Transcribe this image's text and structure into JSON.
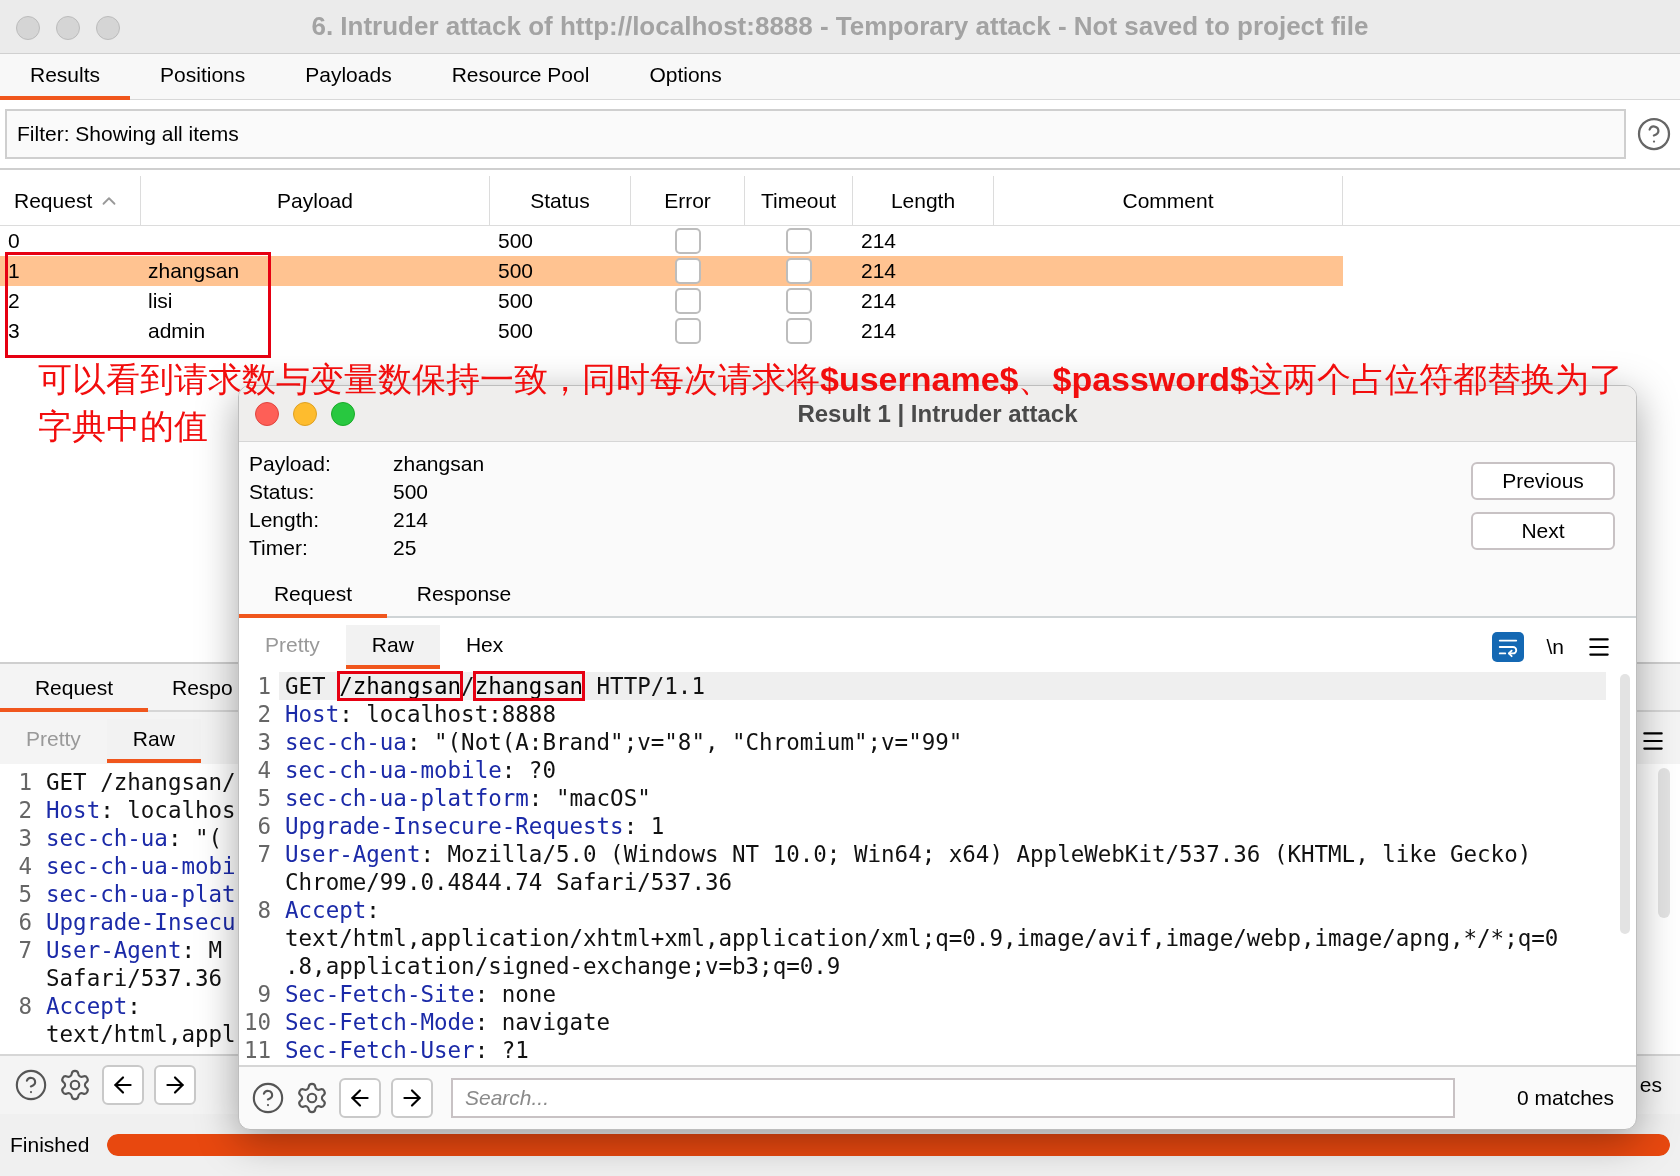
{
  "window": {
    "title": "6. Intruder attack of http://localhost:8888 - Temporary attack - Not saved to project file"
  },
  "tabs": [
    {
      "label": "Results",
      "selected": true
    },
    {
      "label": "Positions",
      "selected": false
    },
    {
      "label": "Payloads",
      "selected": false
    },
    {
      "label": "Resource Pool",
      "selected": false
    },
    {
      "label": "Options",
      "selected": false
    }
  ],
  "filter": {
    "value": "Filter: Showing all items"
  },
  "table": {
    "columns": [
      {
        "label": "Request",
        "sorted": true
      },
      {
        "label": "Payload",
        "sorted": false
      },
      {
        "label": "Status",
        "sorted": false
      },
      {
        "label": "Error",
        "sorted": false
      },
      {
        "label": "Timeout",
        "sorted": false
      },
      {
        "label": "Length",
        "sorted": false
      },
      {
        "label": "Comment",
        "sorted": false
      }
    ],
    "rows": [
      {
        "request": "0",
        "status": "500",
        "error": false,
        "timeout": false,
        "length": "214",
        "selected": false
      },
      {
        "request": "1",
        "payload": "zhangsan",
        "status": "500",
        "error": false,
        "timeout": false,
        "length": "214",
        "selected": true
      },
      {
        "request": "2",
        "payload": "lisi",
        "status": "500",
        "error": false,
        "timeout": false,
        "length": "214",
        "selected": false
      },
      {
        "request": "3",
        "payload": "admin",
        "status": "500",
        "error": false,
        "timeout": false,
        "length": "214",
        "selected": false
      }
    ]
  },
  "annotation": {
    "lines": [
      "可以看到请求数与变量数保持一致，同时每次请求将**$username$**、**$password$**这两个占位符都替换为了",
      "字典中的值"
    ]
  },
  "lower_panel": {
    "tabs": [
      {
        "label": "Request",
        "selected": true
      },
      {
        "label": "Respo",
        "selected": false
      }
    ],
    "view_tabs": [
      {
        "label": "Pretty",
        "selected": false,
        "disabled": true
      },
      {
        "label": "Raw",
        "selected": true,
        "disabled": false
      }
    ],
    "code": [
      {
        "number": "1",
        "segments": [
          {
            "text": "GET /zhangsan/",
            "kind": "plain"
          }
        ]
      },
      {
        "number": "2",
        "segments": [
          {
            "text": "Host",
            "kind": "key"
          },
          {
            "text": ": localhos",
            "kind": "plain"
          }
        ]
      },
      {
        "number": "3",
        "segments": [
          {
            "text": "sec-ch-ua",
            "kind": "key"
          },
          {
            "text": ": \"(",
            "kind": "plain"
          }
        ]
      },
      {
        "number": "4",
        "segments": [
          {
            "text": "sec-ch-ua-mobi",
            "kind": "key"
          }
        ]
      },
      {
        "number": "5",
        "segments": [
          {
            "text": "sec-ch-ua-plat",
            "kind": "key"
          }
        ]
      },
      {
        "number": "6",
        "segments": [
          {
            "text": "Upgrade-Insecu",
            "kind": "key"
          }
        ]
      },
      {
        "number": "7",
        "segments": [
          {
            "text": "User-Agent",
            "kind": "key"
          },
          {
            "text": ": M",
            "kind": "plain"
          }
        ]
      },
      {
        "segments": [
          {
            "text": "Safari/537.36",
            "kind": "plain"
          }
        ]
      },
      {
        "number": "8",
        "segments": [
          {
            "text": "Accept",
            "kind": "key"
          },
          {
            "text": ":",
            "kind": "plain"
          }
        ]
      },
      {
        "segments": [
          {
            "text": "text/html,appl",
            "kind": "plain"
          }
        ]
      }
    ],
    "matches_fragment": "es"
  },
  "status_bar": {
    "text": "Finished",
    "progress": {
      "level": 1
    }
  },
  "dialog": {
    "title": "Result 1 | Intruder attack",
    "fields": [
      {
        "label": "Payload:",
        "value": "zhangsan"
      },
      {
        "label": "Status:",
        "value": "500"
      },
      {
        "label": "Length:",
        "value": "214"
      },
      {
        "label": "Timer:",
        "value": "25"
      }
    ],
    "buttons": [
      "Previous",
      "Next"
    ],
    "tabs": [
      {
        "label": "Request",
        "selected": true
      },
      {
        "label": "Response",
        "selected": false
      }
    ],
    "view_tabs": [
      {
        "label": "Pretty",
        "selected": false,
        "disabled": true
      },
      {
        "label": "Raw",
        "selected": true,
        "disabled": false
      },
      {
        "label": "Hex",
        "selected": false,
        "disabled": false
      }
    ],
    "word_wrap": {
      "on": true
    },
    "newline_toggle": "\\n",
    "code": [
      {
        "number": "1",
        "current": true,
        "segments": [
          {
            "text": "GET ",
            "kind": "plain"
          },
          {
            "text": "/zhangsan",
            "kind": "marked"
          },
          {
            "text": "/",
            "kind": "plain"
          },
          {
            "text": "zhangsan",
            "kind": "marked"
          },
          {
            "text": " HTTP/1.1",
            "kind": "plain"
          }
        ]
      },
      {
        "number": "2",
        "segments": [
          {
            "text": "Host",
            "kind": "key"
          },
          {
            "text": ": localhost:8888",
            "kind": "plain"
          }
        ]
      },
      {
        "number": "3",
        "segments": [
          {
            "text": "sec-ch-ua",
            "kind": "key"
          },
          {
            "text": ": \"(Not(A:Brand\";v=\"8\", \"Chromium\";v=\"99\"",
            "kind": "plain"
          }
        ]
      },
      {
        "number": "4",
        "segments": [
          {
            "text": "sec-ch-ua-mobile",
            "kind": "key"
          },
          {
            "text": ": ?0",
            "kind": "plain"
          }
        ]
      },
      {
        "number": "5",
        "segments": [
          {
            "text": "sec-ch-ua-platform",
            "kind": "key"
          },
          {
            "text": ": \"macOS\"",
            "kind": "plain"
          }
        ]
      },
      {
        "number": "6",
        "segments": [
          {
            "text": "Upgrade-Insecure-Requests",
            "kind": "key"
          },
          {
            "text": ": 1",
            "kind": "plain"
          }
        ]
      },
      {
        "number": "7",
        "segments": [
          {
            "text": "User-Agent",
            "kind": "key"
          },
          {
            "text": ": Mozilla/5.0 (Windows NT 10.0; Win64; x64) AppleWebKit/537.36 (KHTML, like Gecko)",
            "kind": "plain"
          }
        ]
      },
      {
        "segments": [
          {
            "text": "Chrome/99.0.4844.74 Safari/537.36",
            "kind": "plain"
          }
        ]
      },
      {
        "number": "8",
        "segments": [
          {
            "text": "Accept",
            "kind": "key"
          },
          {
            "text": ":",
            "kind": "plain"
          }
        ]
      },
      {
        "segments": [
          {
            "text": "text/html,application/xhtml+xml,application/xml;q=0.9,image/avif,image/webp,image/apng,*/*;q=0",
            "kind": "plain"
          }
        ]
      },
      {
        "segments": [
          {
            "text": ".8,application/signed-exchange;v=b3;q=0.9",
            "kind": "plain"
          }
        ]
      },
      {
        "number": "9",
        "segments": [
          {
            "text": "Sec-Fetch-Site",
            "kind": "key"
          },
          {
            "text": ": none",
            "kind": "plain"
          }
        ]
      },
      {
        "number": "10",
        "segments": [
          {
            "text": "Sec-Fetch-Mode",
            "kind": "key"
          },
          {
            "text": ": navigate",
            "kind": "plain"
          }
        ]
      },
      {
        "number": "11",
        "segments": [
          {
            "text": "Sec-Fetch-User",
            "kind": "key"
          },
          {
            "text": ": ?1",
            "kind": "plain"
          }
        ]
      }
    ],
    "search": {
      "placeholder": "Search..."
    },
    "matches": "0 matches"
  }
}
